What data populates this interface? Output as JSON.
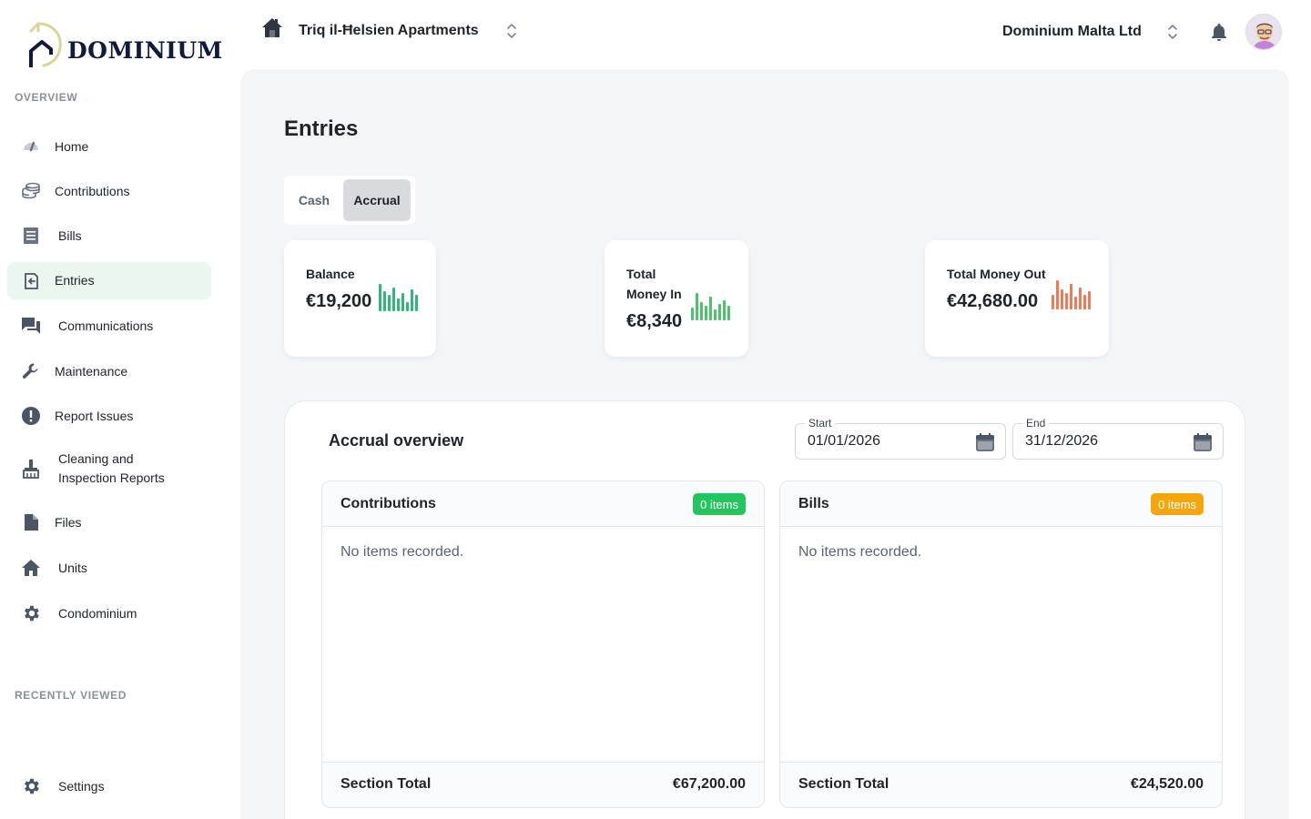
{
  "sidebar": {
    "brand": "Dominium",
    "overview_label": "OVERVIEW",
    "recent_label": "RECENTLY VIEWED",
    "items": [
      {
        "label": "Home"
      },
      {
        "label": "Contributions"
      },
      {
        "label": "Bills"
      },
      {
        "label": "Entries"
      },
      {
        "label": "Communications"
      },
      {
        "label": "Maintenance"
      },
      {
        "label": "Report Issues"
      },
      {
        "label": "Cleaning and Inspection Reports"
      },
      {
        "label": "Files"
      },
      {
        "label": "Units"
      },
      {
        "label": "Condominium"
      }
    ],
    "settings_label": "Settings",
    "active_item": "Entries"
  },
  "header": {
    "property": "Triq il-Ħelsien Apartments",
    "organization": "Dominium Malta Ltd"
  },
  "main": {
    "title": "Entries",
    "toggle": {
      "options": [
        "Cash",
        "Accrual"
      ],
      "selected": "Accrual"
    },
    "stats": [
      {
        "label": "Balance",
        "value": "€19,200",
        "color": "#2eb87a"
      },
      {
        "label": "Total Money In",
        "value": "€8,340",
        "color": "#4cc26a"
      },
      {
        "label": "Total Money Out",
        "value": "€42,680.00",
        "color": "#f07a58"
      }
    ],
    "overview": {
      "title": "Accrual overview",
      "start_label": "Start",
      "start_value": "01/01/2026",
      "end_label": "End",
      "end_value": "31/12/2026",
      "sections": [
        {
          "title": "Contributions",
          "badge": "0 items",
          "badge_color": "#22c55e",
          "empty": "No items recorded.",
          "total_label": "Section Total",
          "total": "€67,200.00"
        },
        {
          "title": "Bills",
          "badge": "0 items",
          "badge_color": "#f5a60a",
          "empty": "No items recorded.",
          "total_label": "Section Total",
          "total": "€24,520.00"
        }
      ]
    }
  }
}
